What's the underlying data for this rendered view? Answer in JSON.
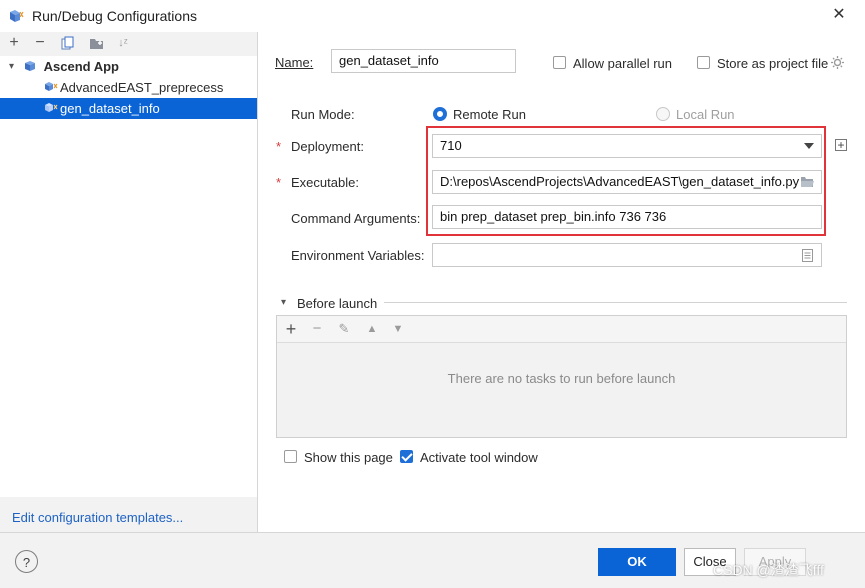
{
  "window": {
    "title": "Run/Debug Configurations"
  },
  "left_toolbar": {
    "icons": [
      "plus-icon",
      "minus-icon",
      "copy-icon",
      "folder-icon",
      "sort-icon"
    ]
  },
  "tree": {
    "items": [
      {
        "label": "Ascend App"
      },
      {
        "label": "AdvancedEAST_preprecess"
      },
      {
        "label": "gen_dataset_info"
      }
    ],
    "edit_templates_link": "Edit configuration templates..."
  },
  "form": {
    "name_label": "Name:",
    "name_value": "gen_dataset_info",
    "allow_parallel_label": "Allow parallel run",
    "store_project_label": "Store as project file",
    "run_mode_label": "Run Mode:",
    "remote_run_label": "Remote Run",
    "local_run_label": "Local Run",
    "deployment_label": "Deployment:",
    "deployment_value": "710",
    "executable_label": "Executable:",
    "executable_value": "D:\\repos\\AscendProjects\\AdvancedEAST\\gen_dataset_info.py",
    "args_label": "Command Arguments:",
    "args_value": "bin prep_dataset prep_bin.info 736 736",
    "env_label": "Environment Variables:",
    "env_value": "",
    "required_mark": "*"
  },
  "before_launch": {
    "title": "Before launch",
    "empty_text": "There are no tasks to run before launch"
  },
  "options": {
    "show_page_label": "Show this page",
    "activate_tool_label": "Activate tool window"
  },
  "footer": {
    "help": "?",
    "ok": "OK",
    "close": "Close",
    "apply": "Apply",
    "watermark": "CSDN @渣渣飞fff"
  },
  "colors": {
    "accent": "#0a64d6",
    "highlight": "#e0333a"
  }
}
